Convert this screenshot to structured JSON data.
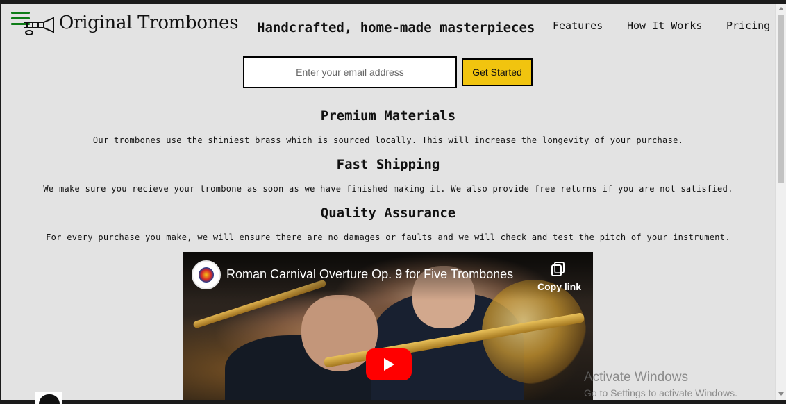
{
  "header": {
    "brand": "Original Trombones",
    "tagline": "Handcrafted, home-made masterpieces",
    "nav": [
      "Features",
      "How It Works",
      "Pricing"
    ]
  },
  "signup": {
    "email_placeholder": "Enter your email address",
    "cta_label": "Get Started"
  },
  "features": [
    {
      "title": "Premium Materials",
      "text": "Our trombones use the shiniest brass which is sourced locally. This will increase the longevity of your purchase."
    },
    {
      "title": "Fast Shipping",
      "text": "We make sure you recieve your trombone as soon as we have finished making it. We also provide free returns if you are not satisfied."
    },
    {
      "title": "Quality Assurance",
      "text": "For every purchase you make, we will ensure there are no damages or faults and we will check and test the pitch of your instrument."
    }
  ],
  "video": {
    "title": "Roman Carnival Overture Op. 9 for Five Trombones",
    "copy_link_label": "Copy link"
  },
  "watermark": {
    "title": "Activate Windows",
    "subtitle": "Go to Settings to activate Windows."
  },
  "colors": {
    "page_bg": "#e3e3e3",
    "cta_bg": "#f1c40f",
    "menu_icon": "#0e7d17",
    "play_button": "#ff0000"
  },
  "icons": [
    "menu-icon",
    "trombone-logo-icon",
    "channel-avatar",
    "copy-link-icon",
    "play-icon"
  ]
}
